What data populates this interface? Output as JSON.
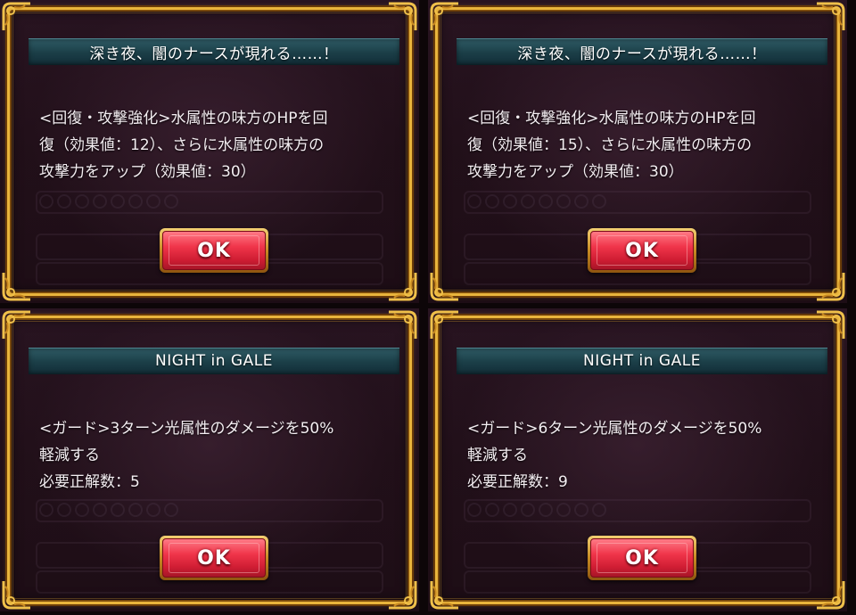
{
  "panels": [
    {
      "title": "深き夜、闇のナースが現れる……！",
      "lines": [
        "<回復・攻撃強化>水属性の味方のHPを回",
        "復（効果値：12）、さらに水属性の味方の",
        "攻撃力をアップ（効果値：30）"
      ],
      "ok_label": "OK"
    },
    {
      "title": "深き夜、闇のナースが現れる……！",
      "lines": [
        "<回復・攻撃強化>水属性の味方のHPを回",
        "復（効果値：15）、さらに水属性の味方の",
        "攻撃力をアップ（効果値：30）"
      ],
      "ok_label": "OK"
    },
    {
      "title": "NIGHT in GALE",
      "lines": [
        "<ガード>3ターン光属性のダメージを50%",
        "軽減する",
        "必要正解数：5"
      ],
      "ok_label": "OK"
    },
    {
      "title": "NIGHT in GALE",
      "lines": [
        "<ガード>6ターン光属性のダメージを50%",
        "軽減する",
        "必要正解数：9"
      ],
      "ok_label": "OK"
    }
  ],
  "colors": {
    "frame_gold": "#e9b43c",
    "title_bar": "#1b3e47",
    "ok_button_red": "#f0354a",
    "panel_bg": "#221019"
  },
  "icons": {
    "corner_ornament": "gold-filigree-corner-icon"
  }
}
